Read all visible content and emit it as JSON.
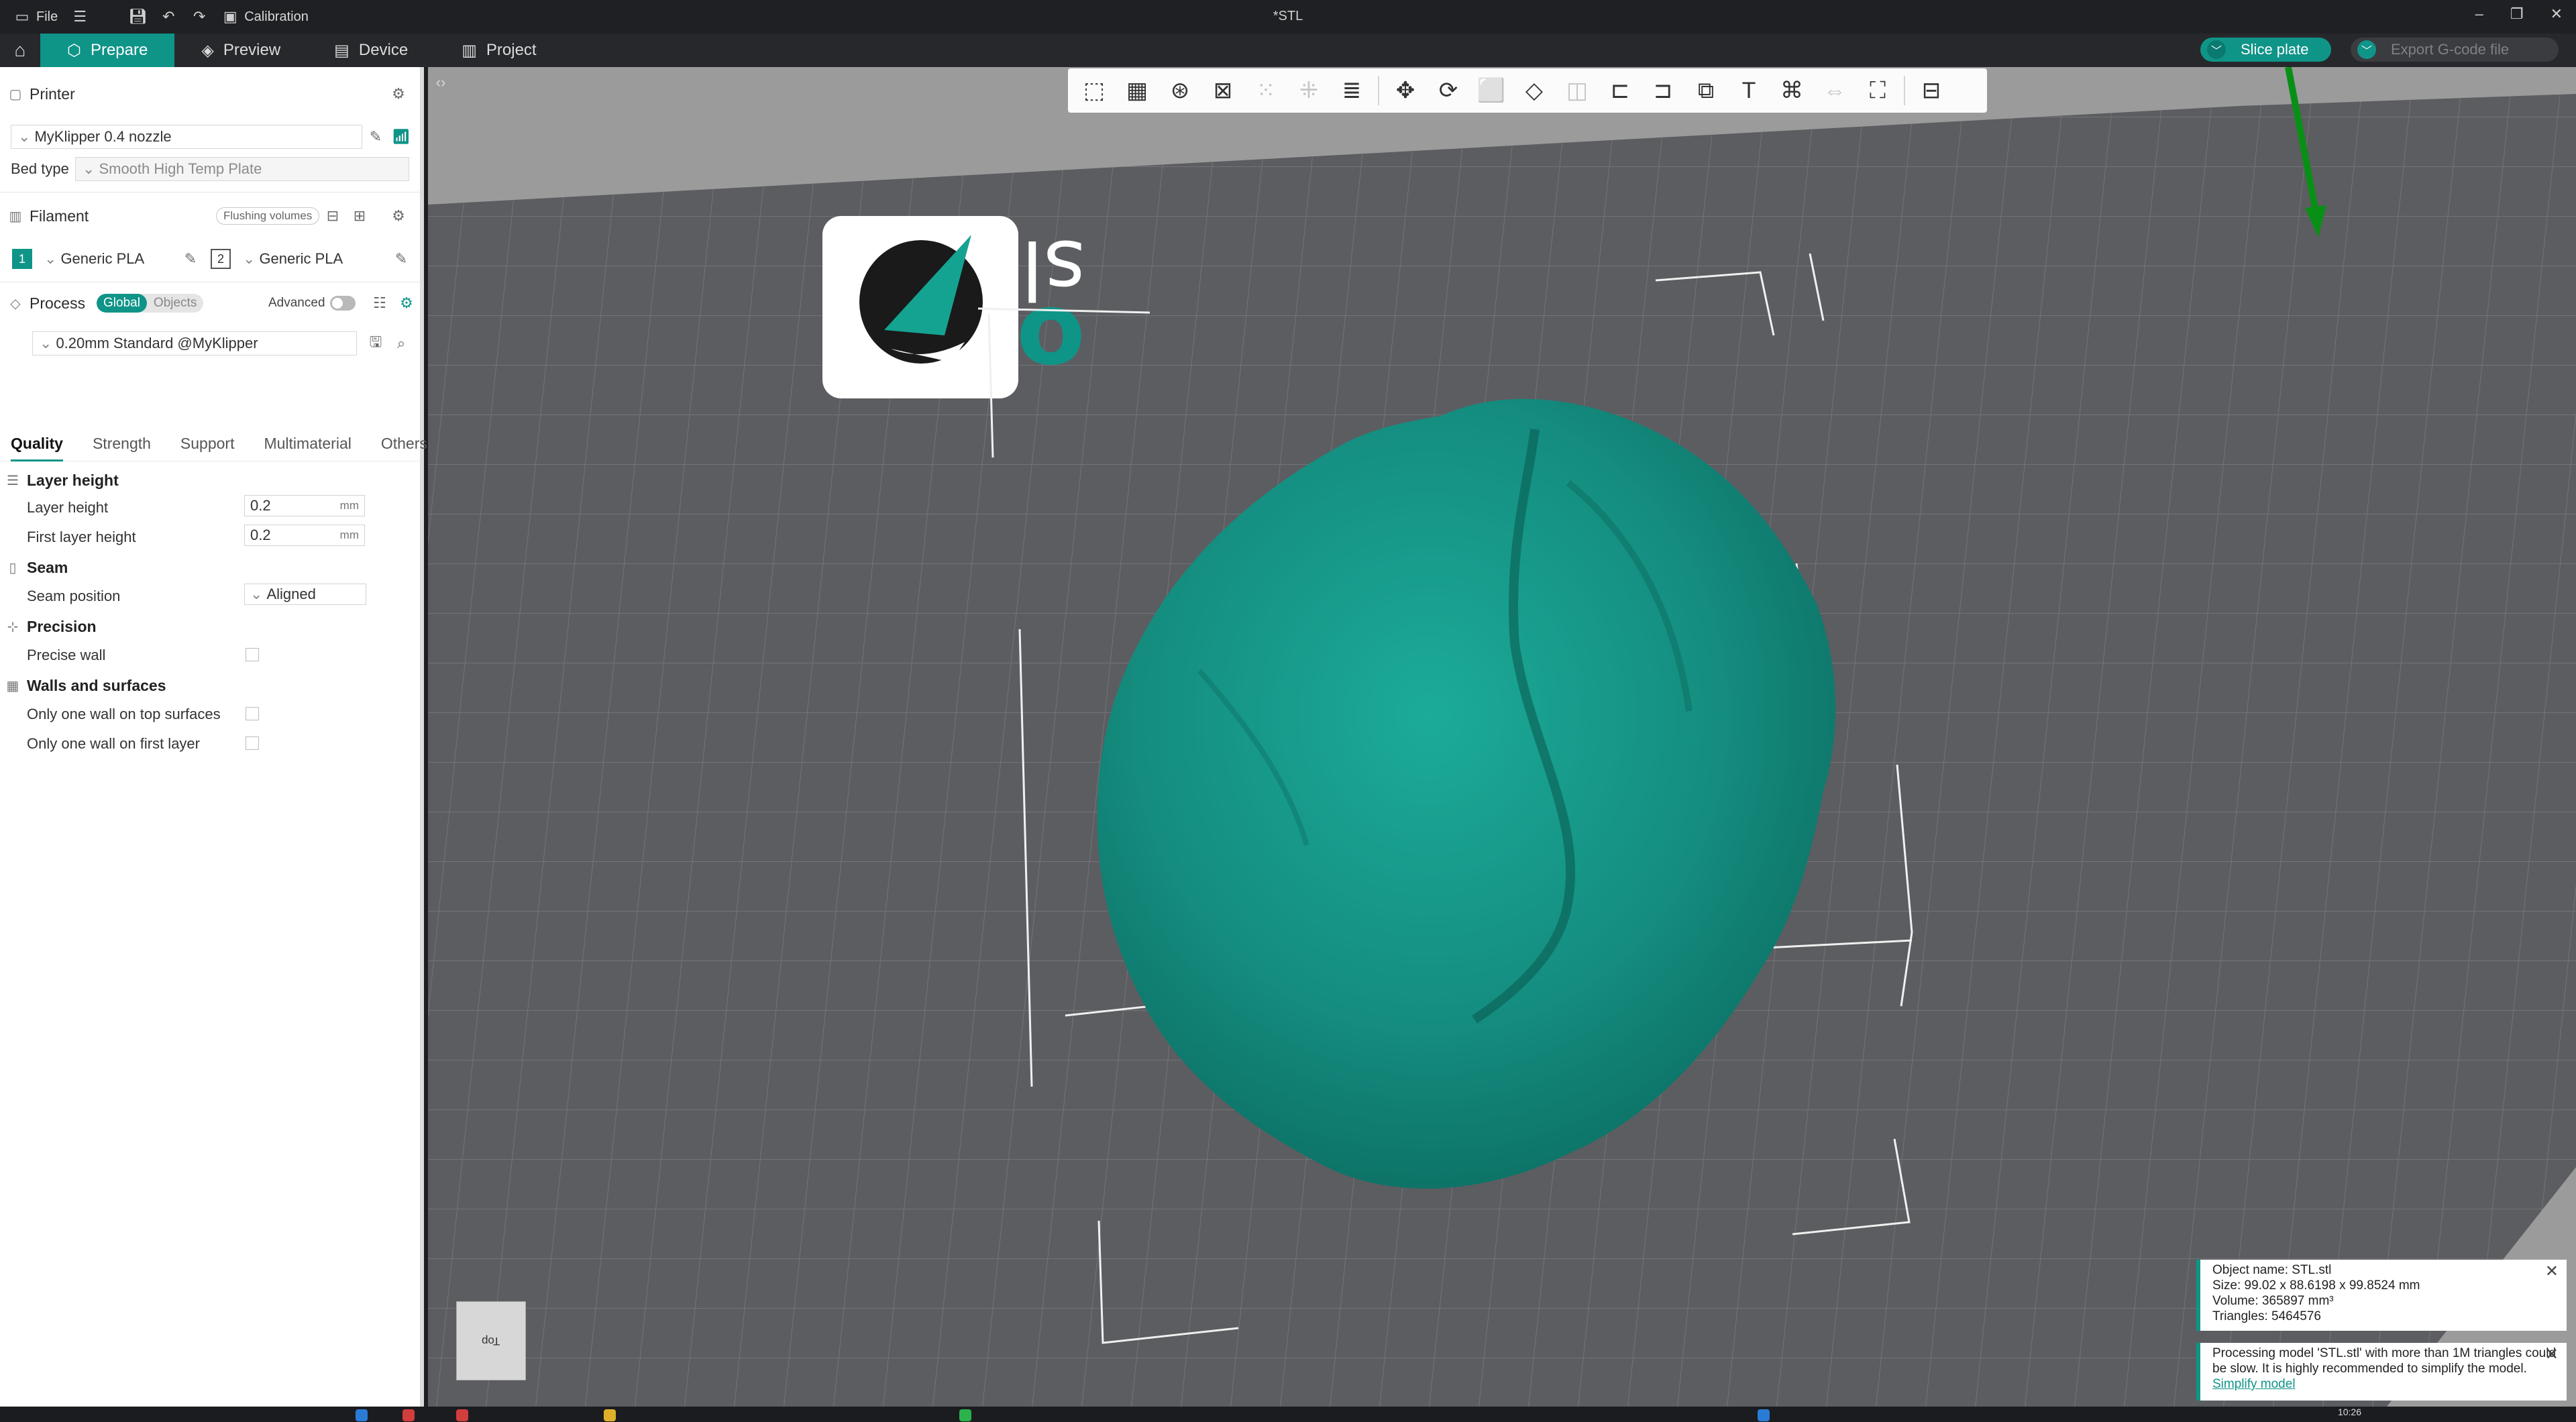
{
  "titlebar": {
    "file_label": "File",
    "calibration_label": "Calibration",
    "title": "*STL"
  },
  "menubar": {
    "tabs": [
      {
        "label": "Prepare",
        "icon": "cube-icon",
        "active": true
      },
      {
        "label": "Preview",
        "icon": "layers-icon",
        "active": false
      },
      {
        "label": "Device",
        "icon": "device-icon",
        "active": false
      },
      {
        "label": "Project",
        "icon": "project-icon",
        "active": false
      }
    ],
    "slice_label": "Slice plate",
    "export_label": "Export G-code file"
  },
  "printer": {
    "section_label": "Printer",
    "name": "MyKlipper 0.4 nozzle",
    "bed_type_label": "Bed type",
    "bed_type_value": "Smooth High Temp Plate"
  },
  "filament": {
    "section_label": "Filament",
    "flushing_label": "Flushing volumes",
    "slots": [
      {
        "index": "1",
        "name": "Generic PLA"
      },
      {
        "index": "2",
        "name": "Generic PLA"
      }
    ]
  },
  "process": {
    "section_label": "Process",
    "global_label": "Global",
    "objects_label": "Objects",
    "advanced_label": "Advanced",
    "preset": "0.20mm Standard @MyKlipper"
  },
  "tabs": [
    "Quality",
    "Strength",
    "Support",
    "Multimaterial",
    "Others"
  ],
  "quality": {
    "layer_height_group": "Layer height",
    "layer_height_label": "Layer height",
    "layer_height_value": "0.2",
    "first_layer_label": "First layer height",
    "first_layer_value": "0.2",
    "unit": "mm",
    "seam_group": "Seam",
    "seam_position_label": "Seam position",
    "seam_position_value": "Aligned",
    "precision_group": "Precision",
    "precise_wall_label": "Precise wall",
    "walls_group": "Walls and surfaces",
    "one_wall_top_label": "Only one wall on top surfaces",
    "one_wall_first_label": "Only one wall on first layer"
  },
  "viewport": {
    "logo_word_top": "slicer",
    "logo_word_bottom": "orca",
    "view_cube_label": "Top",
    "colors": {
      "model": "#16998a",
      "plate": "#5c5d61",
      "accent": "#0f9488"
    }
  },
  "object_info": {
    "name": "Object name: STL.stl",
    "size": "Size: 99.02 x 88.6198 x 99.8524 mm",
    "volume": "Volume: 365897 mm³",
    "triangles": "Triangles: 5464576"
  },
  "processing_note": {
    "text": "Processing model 'STL.stl' with more than 1M triangles could be slow. It is highly recommended to simplify the model.",
    "link": "Simplify model"
  },
  "taskbar": {
    "clock": "10:26"
  }
}
